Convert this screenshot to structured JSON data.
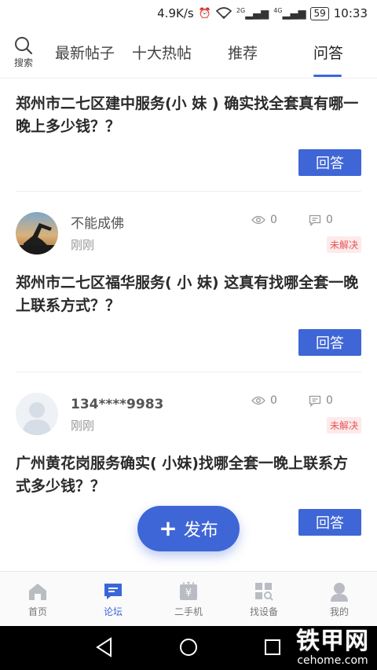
{
  "status_bar": {
    "speed": "4.9K/s",
    "network_2g": "2G",
    "network_4g": "4G",
    "battery": "59",
    "time": "10:33"
  },
  "top_nav": {
    "search_label": "搜索",
    "tabs": [
      {
        "label": "最新帖子"
      },
      {
        "label": "十大热帖"
      },
      {
        "label": "推荐"
      },
      {
        "label": "问答"
      }
    ],
    "active_tab": "问答",
    "accent_color": "#3b66d9"
  },
  "posts": [
    {
      "title": "郑州市二七区建中服务(小 妹 ) 确实找全套真有哪一晚上多少钱？？",
      "answer_label": "回答"
    },
    {
      "user_name": "不能成佛",
      "time": "刚刚",
      "views": "0",
      "comments": "0",
      "status": "未解决",
      "title": "郑州市二七区福华服务( 小 妹) 这真有找哪全套一晚上联系方式？？",
      "answer_label": "回答"
    },
    {
      "user_name": "134****9983",
      "time": "刚刚",
      "views": "0",
      "comments": "0",
      "status": "未解决",
      "title": "广州黄花岗服务确实( 小妹)找哪全套一晚上联系方式多少钱？？",
      "answer_label": "回答"
    }
  ],
  "fab": {
    "label": "发布",
    "icon": "plus-icon"
  },
  "bottom_nav": {
    "items": [
      {
        "label": "首页",
        "icon": "home-icon"
      },
      {
        "label": "论坛",
        "icon": "forum-icon"
      },
      {
        "label": "二手机",
        "icon": "used-machine-icon"
      },
      {
        "label": "找设备",
        "icon": "find-equipment-icon"
      },
      {
        "label": "我的",
        "icon": "profile-icon"
      }
    ],
    "active": "论坛"
  },
  "watermark": {
    "main": "铁甲网",
    "sub": "cehome.com"
  }
}
